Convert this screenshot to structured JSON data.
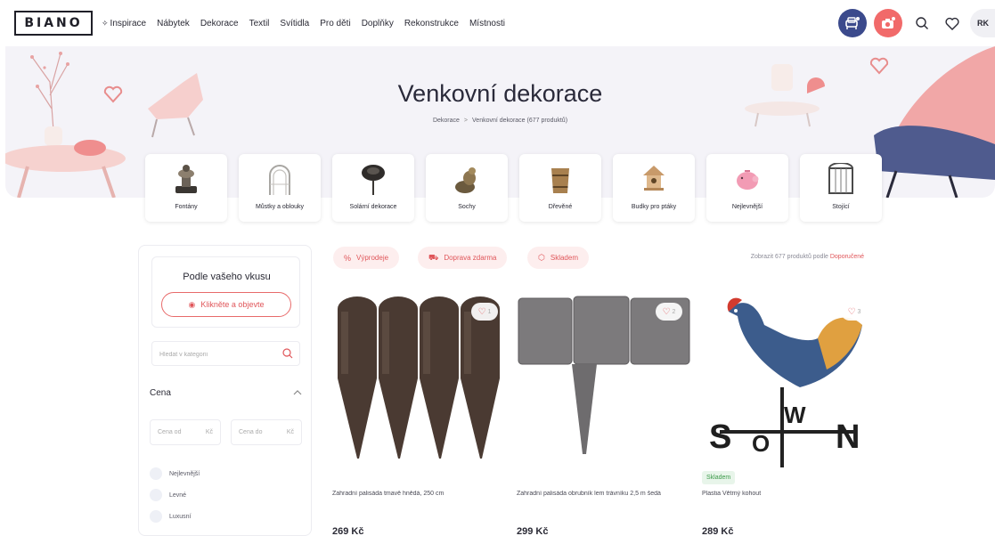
{
  "header": {
    "logo": "BIANO",
    "nav": [
      {
        "label": "Inspirace",
        "icon": "sparkle-icon"
      },
      {
        "label": "Nábytek"
      },
      {
        "label": "Dekorace"
      },
      {
        "label": "Textil"
      },
      {
        "label": "Svítidla"
      },
      {
        "label": "Pro děti"
      },
      {
        "label": "Doplňky"
      },
      {
        "label": "Rekonstrukce"
      },
      {
        "label": "Místnosti"
      }
    ],
    "avatar": "RK",
    "icons": [
      "sofa-search-icon",
      "camera-search-icon",
      "search-icon",
      "heart-icon"
    ]
  },
  "hero": {
    "title": "Venkovní dekorace",
    "breadcrumb": {
      "parent": "Dekorace",
      "separator": ">",
      "current": "Venkovní dekorace (677 produktů)"
    }
  },
  "categories": [
    {
      "label": "Fontány",
      "icon": "fountain-icon"
    },
    {
      "label": "Můstky a oblouky",
      "icon": "arch-icon"
    },
    {
      "label": "Solární dekorace",
      "icon": "solar-lamp-icon"
    },
    {
      "label": "Sochy",
      "icon": "statue-icon"
    },
    {
      "label": "Dřevěné",
      "icon": "wooden-bucket-icon"
    },
    {
      "label": "Budky pro ptáky",
      "icon": "birdhouse-icon"
    },
    {
      "label": "Nejlevnější",
      "icon": "piggy-bank-icon"
    },
    {
      "label": "Stojící",
      "icon": "standing-arch-icon"
    }
  ],
  "sidebar": {
    "taste_title": "Podle vašeho vkusu",
    "taste_button": "Klikněte a objevte",
    "search_placeholder": "Hledat v kategorii",
    "price_title": "Cena",
    "price_from": "Cena od",
    "price_to": "Cena do",
    "currency": "Kč",
    "price_options": [
      "Nejlevnější",
      "Levné",
      "Luxusní"
    ]
  },
  "chips": [
    {
      "label": "Výprodeje",
      "icon": "percent-icon"
    },
    {
      "label": "Doprava zdarma",
      "icon": "truck-icon"
    },
    {
      "label": "Skladem",
      "icon": "box-icon"
    }
  ],
  "sort": {
    "text": "Zobrazit 677 produktů podle",
    "link": "Doporučené"
  },
  "products": [
    {
      "name": "Zahradní palisáda tmavě hnědá, 250 cm",
      "price": "269 Kč",
      "fav": "1",
      "badge": ""
    },
    {
      "name": "Zahradní palisáda obrubník lem trávníku 2,5 m šedá",
      "price": "299 Kč",
      "fav": "2",
      "badge": ""
    },
    {
      "name": "Plastia Větrný kohout",
      "price": "289 Kč",
      "fav": "3",
      "badge": "Skladem"
    }
  ],
  "colors": {
    "accent": "#e0565a",
    "brand_blue": "#3b4a8c",
    "hero_bg": "#f4f3f8"
  }
}
